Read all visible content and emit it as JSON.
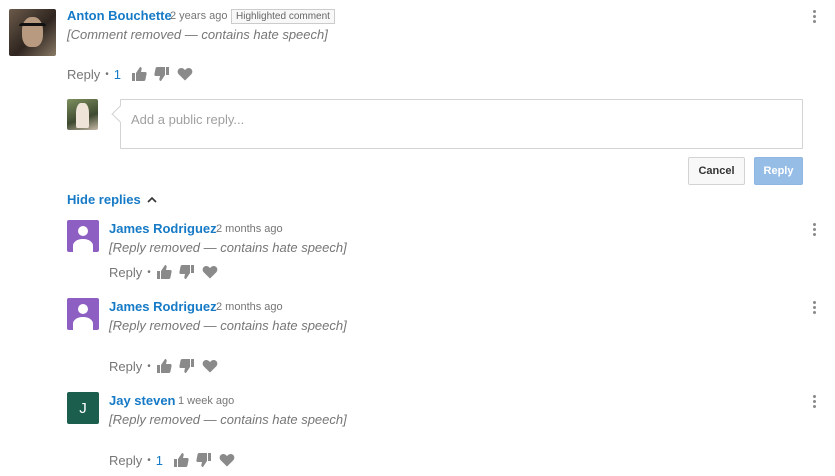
{
  "top_comment": {
    "author": "Anton Bouchette",
    "time": "2 years ago",
    "badge": "Highlighted comment",
    "text": "[Comment removed — contains hate speech]",
    "reply_label": "Reply",
    "like_count": "1"
  },
  "reply_box": {
    "placeholder": "Add a public reply..."
  },
  "buttons": {
    "cancel": "Cancel",
    "reply": "Reply"
  },
  "hide_replies_label": "Hide replies",
  "replies": [
    {
      "author": "James Rodriguez",
      "time": "2 months ago",
      "text": "[Reply removed — contains hate speech]",
      "reply_label": "Reply"
    },
    {
      "author": "James Rodriguez",
      "time": "2 months ago",
      "text": "[Reply removed — contains hate speech]",
      "reply_label": "Reply"
    },
    {
      "author": "Jay steven",
      "time": "1 week ago",
      "avatar_letter": "J",
      "text": "[Reply removed — contains hate speech]",
      "reply_label": "Reply",
      "like_count": "1"
    }
  ],
  "icons": [
    "thumbs-up-icon",
    "thumbs-down-icon",
    "heart-icon",
    "more-vert-icon",
    "chevron-up-icon"
  ],
  "colors": {
    "link_blue": "#167ac6",
    "reply_button_bg": "#96bde6",
    "generic_avatar": "#8e5fc2",
    "letter_avatar": "#1b5e4e"
  }
}
